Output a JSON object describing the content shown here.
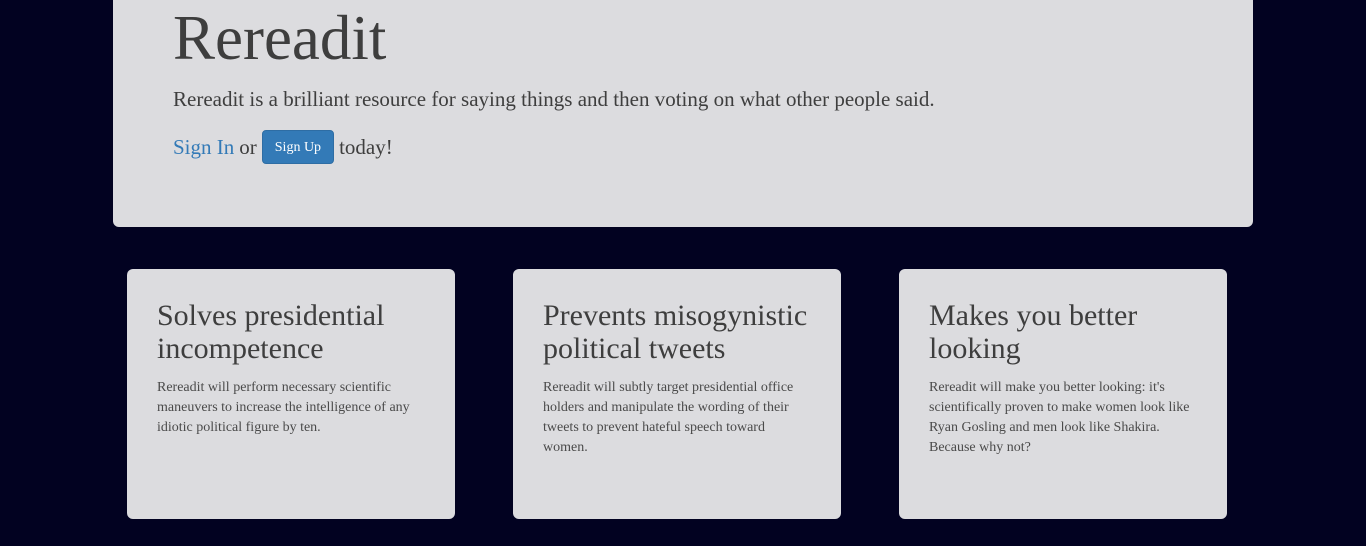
{
  "hero": {
    "title": "Rereadit",
    "tagline": "Rereadit is a brilliant resource for saying things and then voting on what other people said.",
    "sign_in_label": "Sign In",
    "or_text": "or",
    "sign_up_label": "Sign Up",
    "after_text": "today!"
  },
  "features": [
    {
      "title": "Solves presidential incompetence",
      "body": "Rereadit will perform necessary scientific maneuvers to increase the intelligence of any idiotic political figure by ten."
    },
    {
      "title": "Prevents misogynistic political tweets",
      "body": "Rereadit will subtly target presidential office holders and manipulate the wording of their tweets to prevent hateful speech toward women."
    },
    {
      "title": "Makes you better looking",
      "body": "Rereadit will make you better looking: it's scientifically proven to make women look like Ryan Gosling and men look like Shakira. Because why not?"
    }
  ],
  "colors": {
    "page_background": "#020221",
    "panel_background": "#dcdcdf",
    "link": "#337ab7",
    "button": "#337ab7"
  }
}
